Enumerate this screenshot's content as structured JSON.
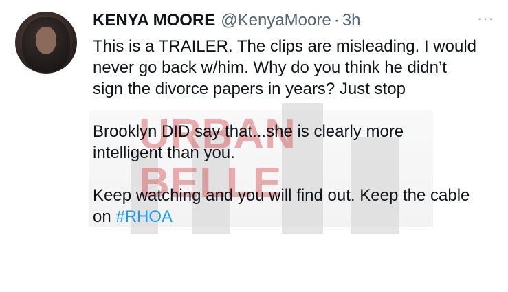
{
  "tweet": {
    "author_name": "KENYA MOORE",
    "handle": "@KenyaMoore",
    "separator": "·",
    "time": "3h",
    "more_label": "···",
    "paragraphs": [
      "This is a TRAILER. The clips are misleading. I would never go back w/him.  Why do you think he didn’t sign the divorce papers in years? Just stop",
      "Brooklyn DID say that...she is clearly more intelligent than you.",
      "Keep watching and you will find out. Keep the cable on "
    ],
    "hashtag": "#RHOA"
  },
  "watermark": {
    "text": "URBAN BELLE"
  },
  "colors": {
    "text": "#0f1419",
    "muted": "#536471",
    "link": "#1d9bf0",
    "watermark": "#d65050"
  },
  "icons": {
    "more": "more-horizontal-icon"
  }
}
